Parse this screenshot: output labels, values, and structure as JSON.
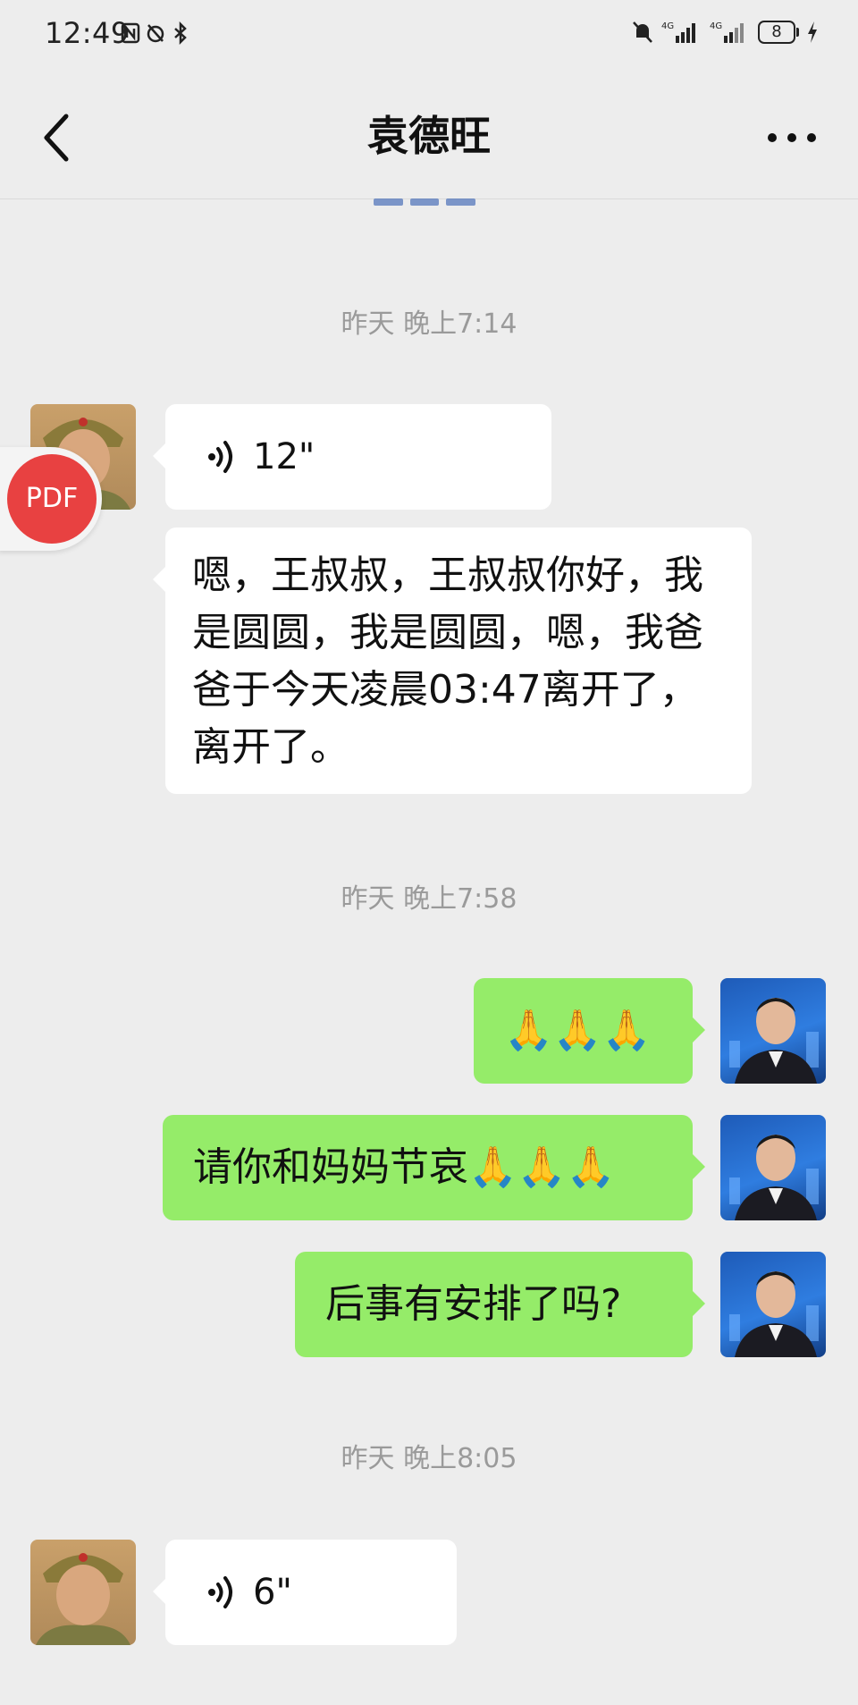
{
  "status_bar": {
    "time": "12:49",
    "battery": "8"
  },
  "header": {
    "title": "袁德旺"
  },
  "messages": {
    "ts1": "昨天 晚上7:14",
    "voice1_duration": "12\"",
    "text1": "嗯，王叔叔，王叔叔你好，我是圆圆，我是圆圆，嗯，我爸爸于今天凌晨03:47离开了，离开了。",
    "ts2": "昨天 晚上7:58",
    "out1": "🙏🙏🙏",
    "out2": "请你和妈妈节哀🙏🙏🙏",
    "out3": "后事有安排了吗?",
    "ts3": "昨天 晚上8:05",
    "voice2_duration": "6\""
  },
  "pdf_badge": {
    "label": "PDF"
  },
  "colors": {
    "background": "#EDEDED",
    "outgoing_bubble": "#95EC69",
    "incoming_bubble": "#FFFFFF",
    "pdf_badge": "#E84141"
  }
}
